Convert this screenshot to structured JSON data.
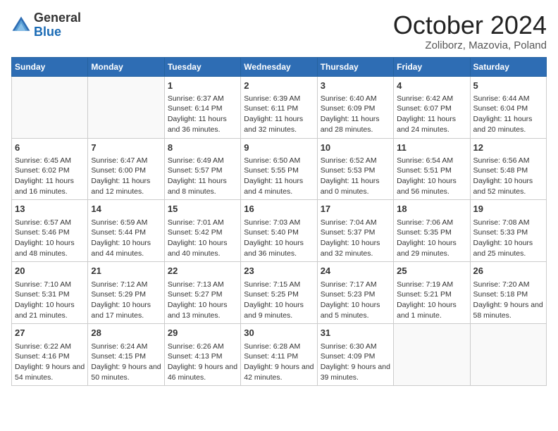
{
  "header": {
    "logo_line1": "General",
    "logo_line2": "Blue",
    "month": "October 2024",
    "location": "Zoliborz, Mazovia, Poland"
  },
  "days_of_week": [
    "Sunday",
    "Monday",
    "Tuesday",
    "Wednesday",
    "Thursday",
    "Friday",
    "Saturday"
  ],
  "weeks": [
    [
      {
        "day": "",
        "info": ""
      },
      {
        "day": "",
        "info": ""
      },
      {
        "day": "1",
        "info": "Sunrise: 6:37 AM\nSunset: 6:14 PM\nDaylight: 11 hours and 36 minutes."
      },
      {
        "day": "2",
        "info": "Sunrise: 6:39 AM\nSunset: 6:11 PM\nDaylight: 11 hours and 32 minutes."
      },
      {
        "day": "3",
        "info": "Sunrise: 6:40 AM\nSunset: 6:09 PM\nDaylight: 11 hours and 28 minutes."
      },
      {
        "day": "4",
        "info": "Sunrise: 6:42 AM\nSunset: 6:07 PM\nDaylight: 11 hours and 24 minutes."
      },
      {
        "day": "5",
        "info": "Sunrise: 6:44 AM\nSunset: 6:04 PM\nDaylight: 11 hours and 20 minutes."
      }
    ],
    [
      {
        "day": "6",
        "info": "Sunrise: 6:45 AM\nSunset: 6:02 PM\nDaylight: 11 hours and 16 minutes."
      },
      {
        "day": "7",
        "info": "Sunrise: 6:47 AM\nSunset: 6:00 PM\nDaylight: 11 hours and 12 minutes."
      },
      {
        "day": "8",
        "info": "Sunrise: 6:49 AM\nSunset: 5:57 PM\nDaylight: 11 hours and 8 minutes."
      },
      {
        "day": "9",
        "info": "Sunrise: 6:50 AM\nSunset: 5:55 PM\nDaylight: 11 hours and 4 minutes."
      },
      {
        "day": "10",
        "info": "Sunrise: 6:52 AM\nSunset: 5:53 PM\nDaylight: 11 hours and 0 minutes."
      },
      {
        "day": "11",
        "info": "Sunrise: 6:54 AM\nSunset: 5:51 PM\nDaylight: 10 hours and 56 minutes."
      },
      {
        "day": "12",
        "info": "Sunrise: 6:56 AM\nSunset: 5:48 PM\nDaylight: 10 hours and 52 minutes."
      }
    ],
    [
      {
        "day": "13",
        "info": "Sunrise: 6:57 AM\nSunset: 5:46 PM\nDaylight: 10 hours and 48 minutes."
      },
      {
        "day": "14",
        "info": "Sunrise: 6:59 AM\nSunset: 5:44 PM\nDaylight: 10 hours and 44 minutes."
      },
      {
        "day": "15",
        "info": "Sunrise: 7:01 AM\nSunset: 5:42 PM\nDaylight: 10 hours and 40 minutes."
      },
      {
        "day": "16",
        "info": "Sunrise: 7:03 AM\nSunset: 5:40 PM\nDaylight: 10 hours and 36 minutes."
      },
      {
        "day": "17",
        "info": "Sunrise: 7:04 AM\nSunset: 5:37 PM\nDaylight: 10 hours and 32 minutes."
      },
      {
        "day": "18",
        "info": "Sunrise: 7:06 AM\nSunset: 5:35 PM\nDaylight: 10 hours and 29 minutes."
      },
      {
        "day": "19",
        "info": "Sunrise: 7:08 AM\nSunset: 5:33 PM\nDaylight: 10 hours and 25 minutes."
      }
    ],
    [
      {
        "day": "20",
        "info": "Sunrise: 7:10 AM\nSunset: 5:31 PM\nDaylight: 10 hours and 21 minutes."
      },
      {
        "day": "21",
        "info": "Sunrise: 7:12 AM\nSunset: 5:29 PM\nDaylight: 10 hours and 17 minutes."
      },
      {
        "day": "22",
        "info": "Sunrise: 7:13 AM\nSunset: 5:27 PM\nDaylight: 10 hours and 13 minutes."
      },
      {
        "day": "23",
        "info": "Sunrise: 7:15 AM\nSunset: 5:25 PM\nDaylight: 10 hours and 9 minutes."
      },
      {
        "day": "24",
        "info": "Sunrise: 7:17 AM\nSunset: 5:23 PM\nDaylight: 10 hours and 5 minutes."
      },
      {
        "day": "25",
        "info": "Sunrise: 7:19 AM\nSunset: 5:21 PM\nDaylight: 10 hours and 1 minute."
      },
      {
        "day": "26",
        "info": "Sunrise: 7:20 AM\nSunset: 5:18 PM\nDaylight: 9 hours and 58 minutes."
      }
    ],
    [
      {
        "day": "27",
        "info": "Sunrise: 6:22 AM\nSunset: 4:16 PM\nDaylight: 9 hours and 54 minutes."
      },
      {
        "day": "28",
        "info": "Sunrise: 6:24 AM\nSunset: 4:15 PM\nDaylight: 9 hours and 50 minutes."
      },
      {
        "day": "29",
        "info": "Sunrise: 6:26 AM\nSunset: 4:13 PM\nDaylight: 9 hours and 46 minutes."
      },
      {
        "day": "30",
        "info": "Sunrise: 6:28 AM\nSunset: 4:11 PM\nDaylight: 9 hours and 42 minutes."
      },
      {
        "day": "31",
        "info": "Sunrise: 6:30 AM\nSunset: 4:09 PM\nDaylight: 9 hours and 39 minutes."
      },
      {
        "day": "",
        "info": ""
      },
      {
        "day": "",
        "info": ""
      }
    ]
  ]
}
